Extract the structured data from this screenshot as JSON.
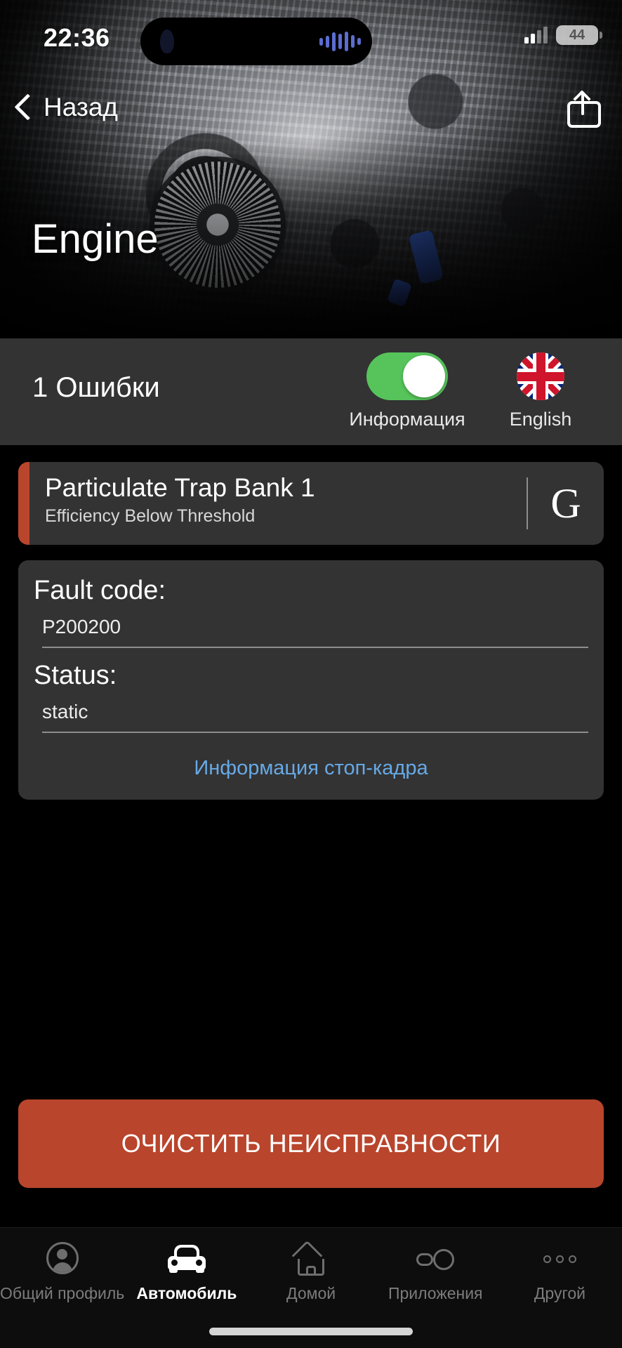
{
  "status_bar": {
    "time": "22:36",
    "battery_level": "44",
    "dynamic_island": {
      "icon": "music-artwork-icon",
      "waveform": "audio-waveform-icon"
    },
    "signal": "cellular-signal-icon"
  },
  "nav": {
    "back_label": "Назад",
    "back_icon": "chevron-left-icon",
    "share_icon": "share-icon"
  },
  "hero": {
    "title": "Engine",
    "image_alt": "engine-photo"
  },
  "summary": {
    "error_count_label": "1 Ошибки",
    "toggle": {
      "label": "Информация",
      "state": "on",
      "on_color": "#56c45b"
    },
    "language": {
      "label": "English",
      "flag": "uk-flag-icon"
    }
  },
  "fault": {
    "title": "Particulate Trap Bank 1",
    "subtitle": "Efficiency Below Threshold",
    "accent_color": "#b9452c",
    "search_button_label": "G"
  },
  "details": {
    "fault_code_label": "Fault code:",
    "fault_code_value": "P200200",
    "status_label": "Status:",
    "status_value": "static",
    "freeze_frame_link": "Информация стоп-кадра",
    "link_color": "#67a9e6"
  },
  "actions": {
    "clear_button_label": "ОЧИСТИТЬ НЕИСПРАВНОСТИ",
    "clear_button_color": "#b9452c"
  },
  "tabbar": {
    "items": [
      {
        "label": "Общий профиль",
        "icon": "person-circle-icon",
        "active": false
      },
      {
        "label": "Автомобиль",
        "icon": "car-icon",
        "active": true
      },
      {
        "label": "Домой",
        "icon": "home-icon",
        "active": false
      },
      {
        "label": "Приложения",
        "icon": "apps-icon",
        "active": false
      },
      {
        "label": "Другой",
        "icon": "more-dots-icon",
        "active": false
      }
    ]
  }
}
